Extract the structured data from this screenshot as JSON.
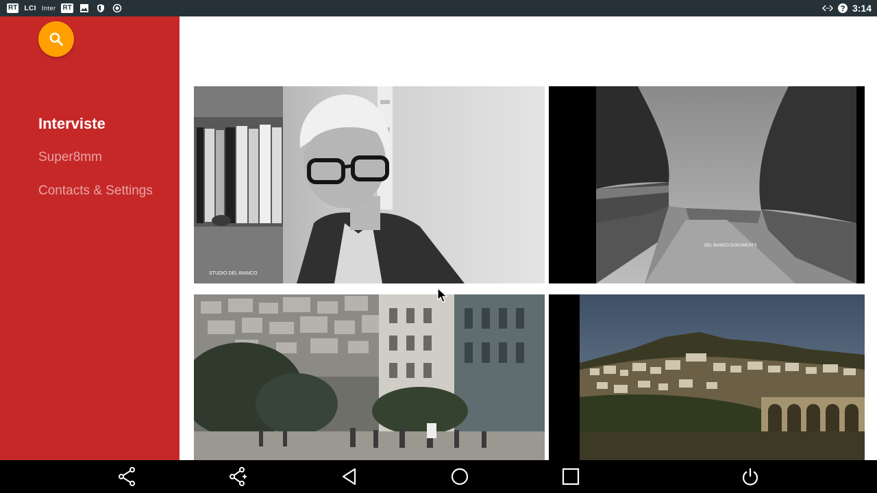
{
  "status_bar": {
    "left_items": [
      {
        "kind": "chip",
        "text": "RT"
      },
      {
        "kind": "text",
        "text": "LCI"
      },
      {
        "kind": "thin",
        "text": "Inter"
      },
      {
        "kind": "chip",
        "text": "RT"
      }
    ],
    "icons": [
      "image-icon",
      "shield-icon",
      "record-icon"
    ],
    "right_icons": [
      "code-icon",
      "help-circle-icon"
    ],
    "time": "3:14"
  },
  "sidebar": {
    "search_icon": "search-icon",
    "colors": {
      "background": "#c62828",
      "fab": "#ffa000"
    },
    "items": [
      {
        "label": "Interviste",
        "active": true
      },
      {
        "label": "Super8mm",
        "active": false
      },
      {
        "label": "Contacts & Settings",
        "active": false
      }
    ]
  },
  "grid": {
    "thumbnails": [
      {
        "name": "interview-thumbnail",
        "caption": "STUDIO DEL BIANCO"
      },
      {
        "name": "road-thumbnail",
        "caption": "DEL BIANCO DOCUMENTS"
      },
      {
        "name": "town-street-thumbnail",
        "caption": ""
      },
      {
        "name": "hill-town-thumbnail",
        "caption": ""
      }
    ]
  },
  "nav_bar": {
    "buttons": [
      "share-icon",
      "share-add-icon",
      "back-icon",
      "home-icon",
      "recents-icon",
      "power-icon"
    ]
  }
}
